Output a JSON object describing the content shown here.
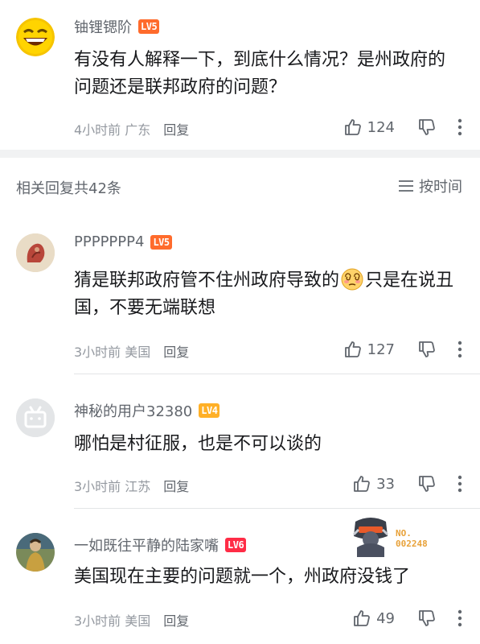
{
  "top_comment": {
    "username": "铀锂锶阶",
    "level": "LV5",
    "content": "有没有人解释一下，到底什么情况？是州政府的问题还是联邦政府的问题？",
    "time": "4小时前",
    "location": "广东",
    "reply_label": "回复",
    "likes": "124",
    "avatar_icon": "laughing-emoji-avatar"
  },
  "replies_header": {
    "count_label": "相关回复共42条",
    "sort_label": "按时间"
  },
  "replies": [
    {
      "username": "PPPPPPP4",
      "level": "LV5",
      "content_before": "猜是联邦政府管不住州政府导致的",
      "content_after": "只是在说丑国，不要无端联想",
      "emoji": "dizzy-face-emoji",
      "time": "3小时前",
      "location": "美国",
      "reply_label": "回复",
      "likes": "127"
    },
    {
      "username": "神秘的用户32380",
      "level": "LV4",
      "content": "哪怕是村征服，也是不可以谈的",
      "time": "3小时前",
      "location": "江苏",
      "reply_label": "回复",
      "likes": "33"
    },
    {
      "username": "一如既往平静的陆家嘴",
      "level": "LV6",
      "content": "美国现在主要的问题就一个，州政府没钱了",
      "time": "3小时前",
      "location": "美国",
      "reply_label": "回复",
      "likes": "49",
      "badge_text": "NO.",
      "badge_number": "002248"
    }
  ],
  "colors": {
    "lv5": "#ff6b2c",
    "lv4": "#ffb027",
    "lv6": "#ff2c46",
    "meta": "#9499a0",
    "divider": "#f1f2f3"
  }
}
